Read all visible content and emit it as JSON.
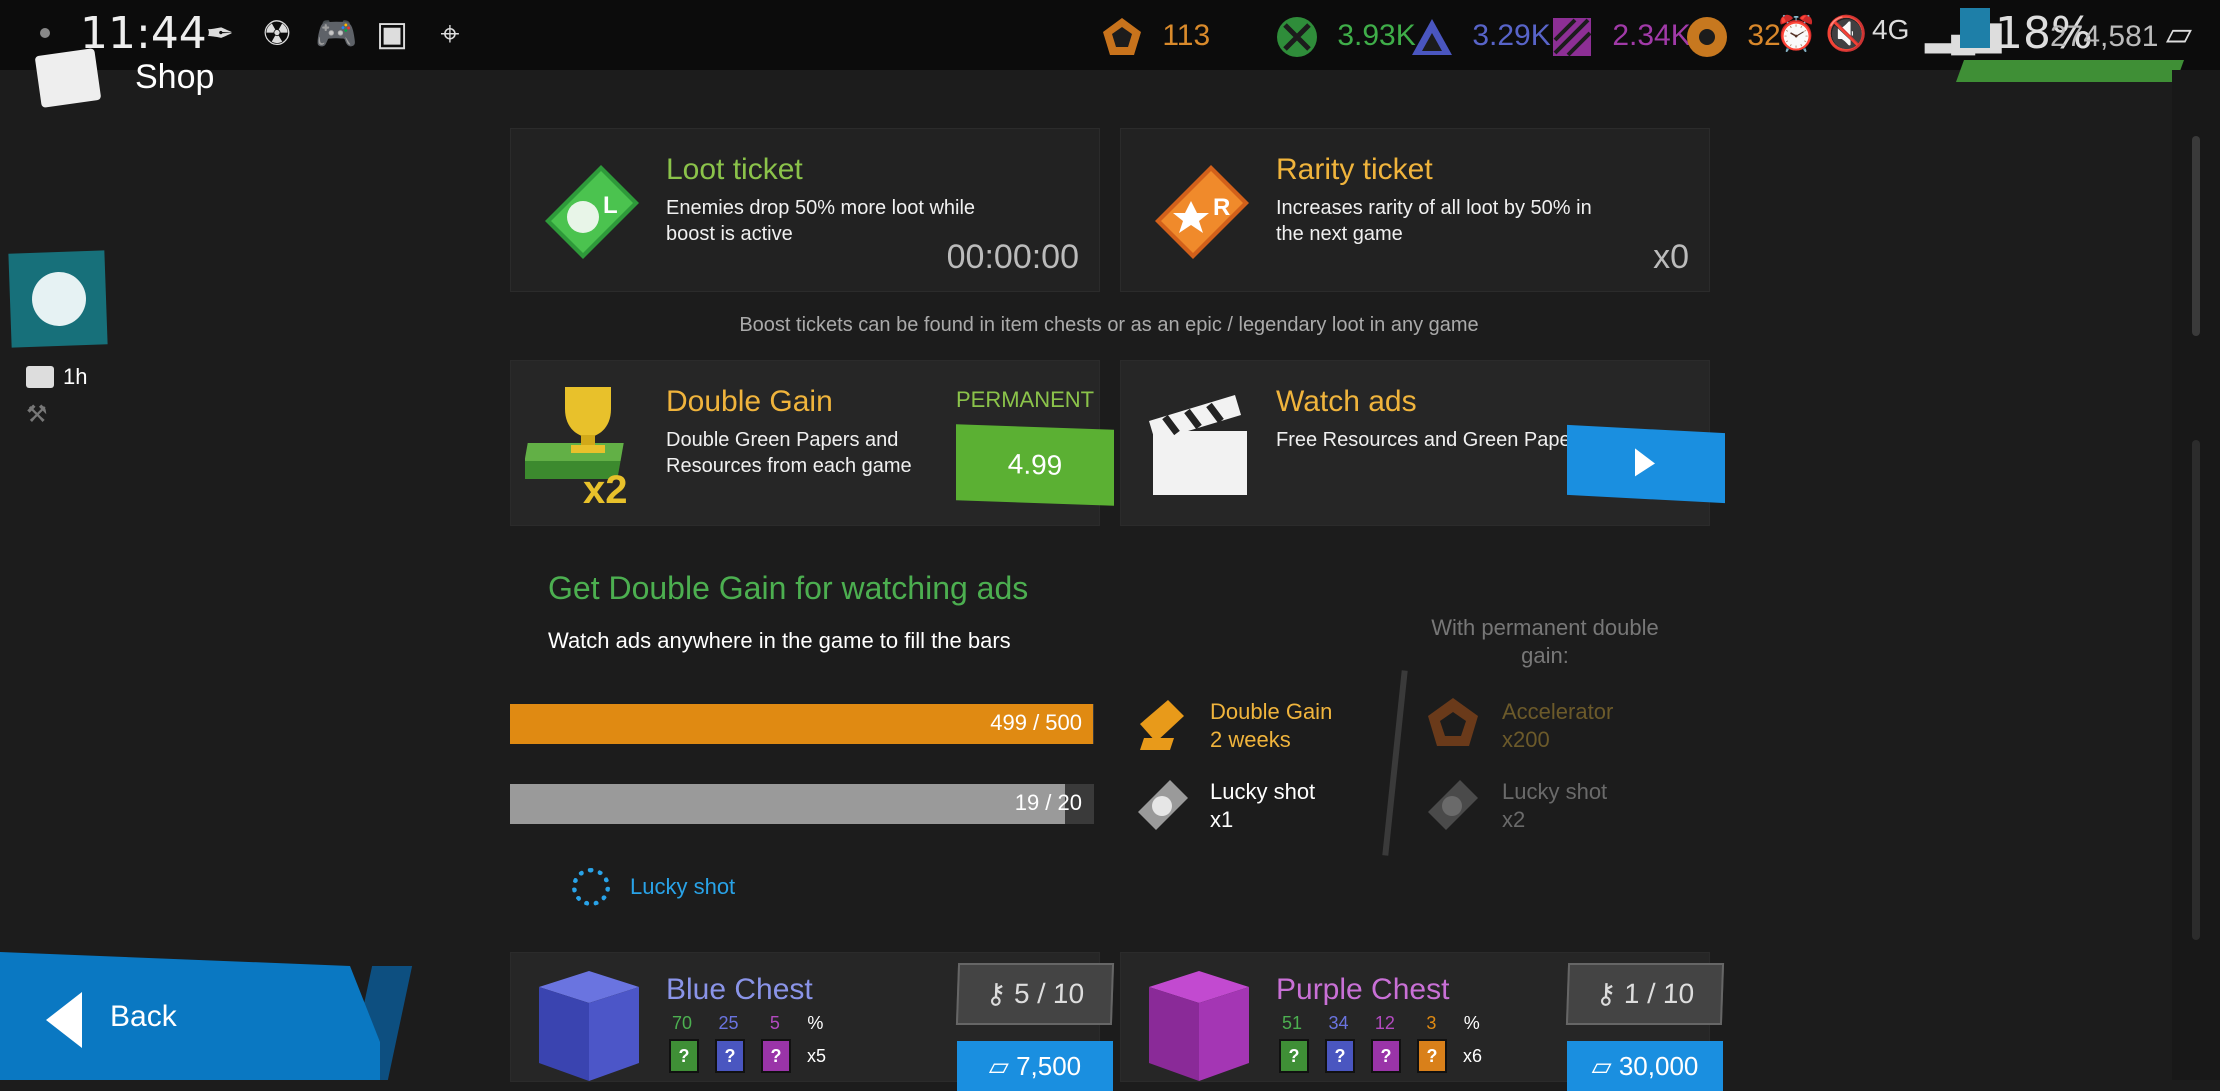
{
  "status_bar": {
    "time": "11:44",
    "icons": [
      "feather-icon",
      "radiation-icon",
      "gamepad-icon",
      "image-icon",
      "location-icon"
    ],
    "resources": [
      {
        "name": "pentagon-resource-icon",
        "value": "113",
        "color": "#d98a2b"
      },
      {
        "name": "green-resource-icon",
        "value": "3.93K",
        "color": "#3fae49"
      },
      {
        "name": "blue-resource-icon",
        "value": "3.29K",
        "color": "#5864c8"
      },
      {
        "name": "purple-resource-icon",
        "value": "2.34K",
        "color": "#a13aa8"
      },
      {
        "name": "orange-resource-icon",
        "value": "320",
        "color": "#d9882b"
      }
    ],
    "battery": "18%",
    "network": "4G",
    "papers": "274,581"
  },
  "header": {
    "title": "Shop"
  },
  "left_sidebar": {
    "timer": "1h"
  },
  "loot_ticket": {
    "title": "Loot ticket",
    "desc_line1": "Enemies drop 50% more loot while",
    "desc_line2": "boost is active",
    "value": "00:00:00",
    "badge": "L"
  },
  "rarity_ticket": {
    "title": "Rarity ticket",
    "desc_line1": "Increases rarity of all loot by 50% in",
    "desc_line2": "the next game",
    "value": "x0",
    "badge": "R"
  },
  "boost_note": "Boost tickets can be found in item chests or as an epic / legendary loot in any game",
  "double_gain": {
    "title": "Double Gain",
    "desc_line1": "Double Green Papers and",
    "desc_line2": "Resources from each game",
    "tag": "PERMANENT",
    "price": "4.99",
    "badge": "x2"
  },
  "watch_ads": {
    "title": "Watch ads",
    "desc": "Free Resources and Green Papers"
  },
  "ads_section": {
    "title": "Get Double Gain for watching ads",
    "subtitle": "Watch ads anywhere in the game to fill the bars",
    "bars": [
      {
        "text": "499 / 500",
        "fraction": 0.998,
        "color": "#e08a12"
      },
      {
        "text": "19 / 20",
        "fraction": 0.95,
        "color": "#9a9a9a"
      }
    ],
    "reward1_line1": "Double Gain",
    "reward1_line2": "2 weeks",
    "reward2_line1": "Lucky shot",
    "reward2_line2": "x1",
    "perm_note": "With permanent double gain:",
    "perm1_line1": "Accelerator",
    "perm1_line2": "x200",
    "perm2_line1": "Lucky shot",
    "perm2_line2": "x2",
    "lucky_link": "Lucky shot"
  },
  "blue_chest": {
    "title": "Blue Chest",
    "percents": [
      "70",
      "25",
      "5"
    ],
    "pct_sign": "%",
    "multiplier": "x5",
    "keys": "5 / 10",
    "price": "7,500",
    "q": "?"
  },
  "purple_chest": {
    "title": "Purple Chest",
    "percents": [
      "51",
      "34",
      "12",
      "3"
    ],
    "pct_sign": "%",
    "multiplier": "x6",
    "keys": "1 / 10",
    "price": "30,000",
    "q": "?"
  },
  "back_button": {
    "label": "Back"
  },
  "colors": {
    "green": "#8bc34a",
    "orange": "#f0b43c",
    "blue_btn": "#1a8fe0",
    "price_green": "#5bb033"
  }
}
